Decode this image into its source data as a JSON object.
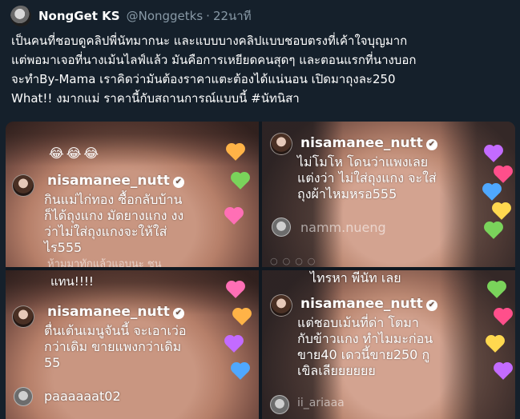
{
  "tweet": {
    "display_name": "NongGet KS",
    "handle": "@Nonggetks",
    "separator": "·",
    "time": "22นาที",
    "text_lines": [
      "เป็นคนที่ชอบดูคลิปพี่นัทมากนะ และแบบบางคลิปแบบชอบตรงที่เค้าใจบุญมาก",
      "แต่พอมาเจอที่นางเม้นไลฟ์แล้ว มันคือการเหยียดคนสุดๆ และตอนแรกที่นางบอก",
      "จะทำBy-Mama เราคิดว่ามันต้องราคาแตะต้องได้แน่นอน เปิดมาถุงละ250",
      "What!! งมากแม่ ราคานี้กับสถานการณ์แบบนี้ #นัทนิสา"
    ]
  },
  "media": {
    "panel1": {
      "emojis": "😂😂😂",
      "commenter": "nisamanee_nutt",
      "lines": [
        "กินแม่ไก่ทอง ซื้อกลับบ้าน",
        "ก็ได้ถุงแกง มัดยางแกง งง",
        "ว่าไม่ใส่ถุงแกงจะให้ใส่",
        "ไร555"
      ],
      "ghost_line": "ห้ามมาทักแล้วแอบนะ ชน"
    },
    "panel2": {
      "commenter": "nisamanee_nutt",
      "lines": [
        "ไม่โมโห โดนว่าแพงเลย",
        "แต่งว่า ไม่ใส่ถุงแกง จะใส่",
        "ถุงผ้าไหมหรอ555"
      ],
      "next_commenter": "namm.nueng",
      "below_text": "ไทรหา พีนัท เลย"
    },
    "panel3": {
      "top_line": "แทน!!!!",
      "commenter": "nisamanee_nutt",
      "lines": [
        "ตื่นเต้นเมนูจันนี้ จะเอาเว่อ",
        "กว่าเดิม ขายแพงกว่าเดิม",
        "55"
      ],
      "next_commenter": "paaaaaat02"
    },
    "panel4": {
      "commenter": "nisamanee_nutt",
      "lines": [
        "แต่ชอบเม้นที่ด่า โตมา",
        "กับข้าวแกง ทำไมมะก่อน",
        "ขาย40 เดวนี้ขาย250 กู",
        "เขิลเลียยยยยย"
      ],
      "next_commenter": "ii_ariaaa"
    },
    "verified_glyph": "✔",
    "reaction_glyphs": "○○○○"
  },
  "colors": {
    "background": "#15202b",
    "secondary_text": "#8899a6",
    "hearts": [
      "#ff4f8b",
      "#ffb347",
      "#7ad35b",
      "#4fa8ff",
      "#c36bff",
      "#ff6fb5",
      "#ffd84f"
    ]
  }
}
